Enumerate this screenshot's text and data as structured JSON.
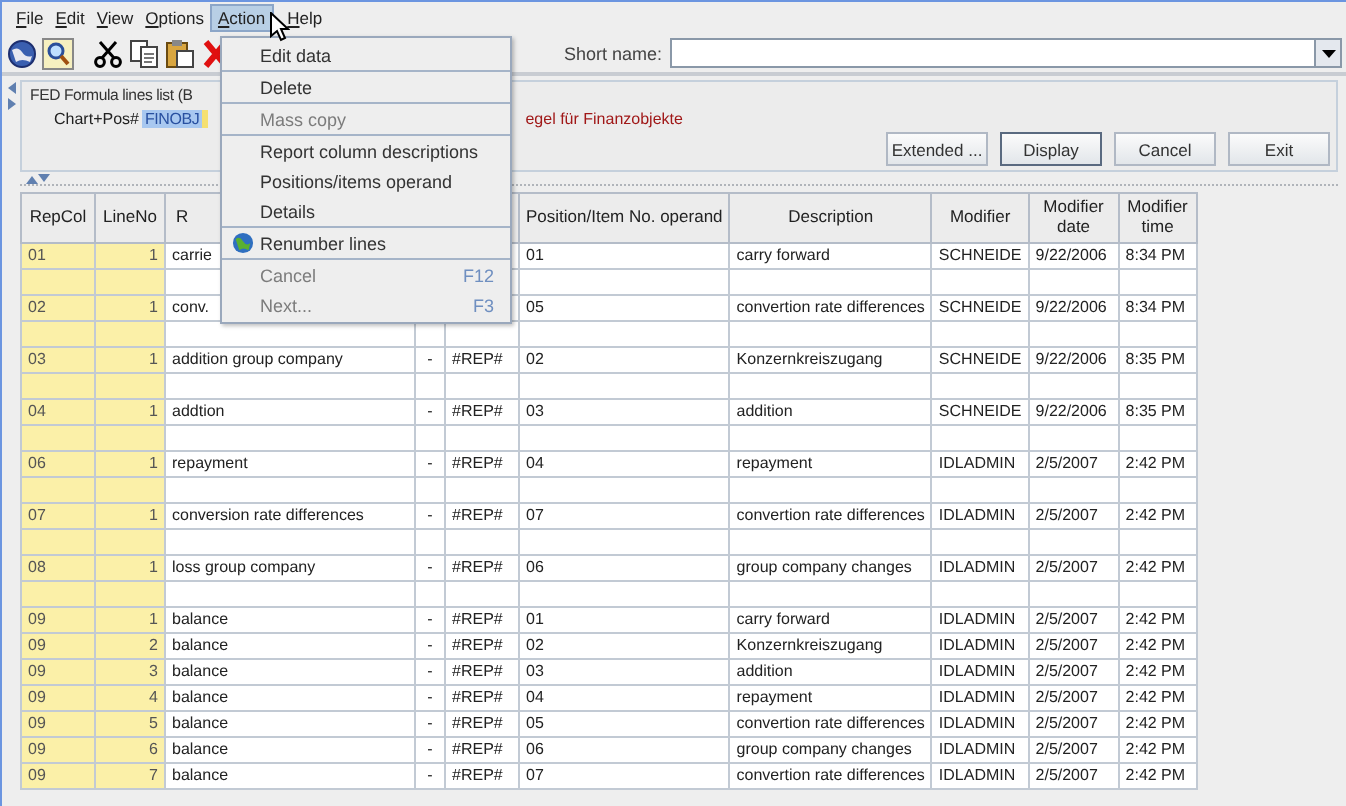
{
  "menubar": [
    {
      "label": "File",
      "selected": false
    },
    {
      "label": "Edit",
      "selected": false
    },
    {
      "label": "View",
      "selected": false
    },
    {
      "label": "Options",
      "selected": false
    },
    {
      "label": "Action",
      "selected": true
    },
    {
      "label": "Help",
      "selected": false
    }
  ],
  "toolbar": {
    "short_name_label": "Short name:"
  },
  "panel": {
    "title": "FED Formula lines list (B",
    "chart_label": "Chart+Pos#",
    "chart_value": "FINOBJ",
    "description": "egel für Finanzobjekte"
  },
  "buttons": [
    {
      "label": "Extended ...",
      "default": false
    },
    {
      "label": "Display",
      "default": true
    },
    {
      "label": "Cancel",
      "default": false
    },
    {
      "label": "Exit",
      "default": false
    }
  ],
  "table": {
    "columns": [
      "RepCol",
      "LineNo",
      "R",
      null,
      null,
      "Position/Item No. operand",
      "Description",
      "Modifier",
      "Modifier date",
      "Modifier time"
    ],
    "rows": [
      {
        "kind": "data",
        "cells": [
          "01",
          "1",
          "carrie",
          null,
          null,
          "01",
          "carry forward",
          "SCHNEIDE",
          "9/22/2006",
          "8:34 PM"
        ]
      },
      {
        "kind": "spacer"
      },
      {
        "kind": "data",
        "cells": [
          "02",
          "1",
          "conv.",
          null,
          null,
          "05",
          "convertion rate differences",
          "SCHNEIDE",
          "9/22/2006",
          "8:34 PM"
        ]
      },
      {
        "kind": "spacer"
      },
      {
        "kind": "data",
        "cells": [
          "03",
          "1",
          "addition group company",
          "-",
          "#REP#",
          "02",
          "Konzernkreiszugang",
          "SCHNEIDE",
          "9/22/2006",
          "8:35 PM"
        ]
      },
      {
        "kind": "spacer"
      },
      {
        "kind": "data",
        "cells": [
          "04",
          "1",
          "addtion",
          "-",
          "#REP#",
          "03",
          "addition",
          "SCHNEIDE",
          "9/22/2006",
          "8:35 PM"
        ]
      },
      {
        "kind": "spacer"
      },
      {
        "kind": "data",
        "cells": [
          "06",
          "1",
          "repayment",
          "-",
          "#REP#",
          "04",
          "repayment",
          "IDLADMIN",
          "2/5/2007",
          "2:42 PM"
        ]
      },
      {
        "kind": "spacer"
      },
      {
        "kind": "data",
        "cells": [
          "07",
          "1",
          "conversion rate differences",
          "-",
          "#REP#",
          "07",
          "convertion rate differences",
          "IDLADMIN",
          "2/5/2007",
          "2:42 PM"
        ]
      },
      {
        "kind": "spacer"
      },
      {
        "kind": "data",
        "cells": [
          "08",
          "1",
          "loss group company",
          "-",
          "#REP#",
          "06",
          "group company changes",
          "IDLADMIN",
          "2/5/2007",
          "2:42 PM"
        ]
      },
      {
        "kind": "spacer"
      },
      {
        "kind": "data",
        "cells": [
          "09",
          "1",
          "balance",
          "-",
          "#REP#",
          "01",
          "carry forward",
          "IDLADMIN",
          "2/5/2007",
          "2:42 PM"
        ]
      },
      {
        "kind": "data",
        "cells": [
          "09",
          "2",
          "balance",
          "-",
          "#REP#",
          "02",
          "Konzernkreiszugang",
          "IDLADMIN",
          "2/5/2007",
          "2:42 PM"
        ]
      },
      {
        "kind": "data",
        "cells": [
          "09",
          "3",
          "balance",
          "-",
          "#REP#",
          "03",
          "addition",
          "IDLADMIN",
          "2/5/2007",
          "2:42 PM"
        ]
      },
      {
        "kind": "data",
        "cells": [
          "09",
          "4",
          "balance",
          "-",
          "#REP#",
          "04",
          "repayment",
          "IDLADMIN",
          "2/5/2007",
          "2:42 PM"
        ]
      },
      {
        "kind": "data",
        "cells": [
          "09",
          "5",
          "balance",
          "-",
          "#REP#",
          "05",
          "convertion rate differences",
          "IDLADMIN",
          "2/5/2007",
          "2:42 PM"
        ]
      },
      {
        "kind": "data",
        "cells": [
          "09",
          "6",
          "balance",
          "-",
          "#REP#",
          "06",
          "group company changes",
          "IDLADMIN",
          "2/5/2007",
          "2:42 PM"
        ]
      },
      {
        "kind": "data",
        "cells": [
          "09",
          "7",
          "balance",
          "-",
          "#REP#",
          "07",
          "convertion rate differences",
          "IDLADMIN",
          "2/5/2007",
          "2:42 PM"
        ]
      }
    ]
  },
  "action_menu": [
    {
      "kind": "item",
      "label": "Edit data",
      "disabled": false
    },
    {
      "kind": "separator"
    },
    {
      "kind": "item",
      "label": "Delete",
      "disabled": false
    },
    {
      "kind": "separator"
    },
    {
      "kind": "item",
      "label": "Mass copy",
      "disabled": true
    },
    {
      "kind": "separator"
    },
    {
      "kind": "item",
      "label": "Report column descriptions",
      "disabled": false
    },
    {
      "kind": "item",
      "label": "Positions/items operand",
      "disabled": false
    },
    {
      "kind": "item",
      "label": "Details",
      "disabled": false
    },
    {
      "kind": "separator"
    },
    {
      "kind": "globe-item",
      "label": "Renumber lines",
      "disabled": false
    },
    {
      "kind": "separator"
    },
    {
      "kind": "item",
      "label": "Cancel",
      "shortcut": "F12",
      "disabled": true
    },
    {
      "kind": "item",
      "label": "Next...",
      "shortcut": "F3",
      "disabled": true
    }
  ]
}
